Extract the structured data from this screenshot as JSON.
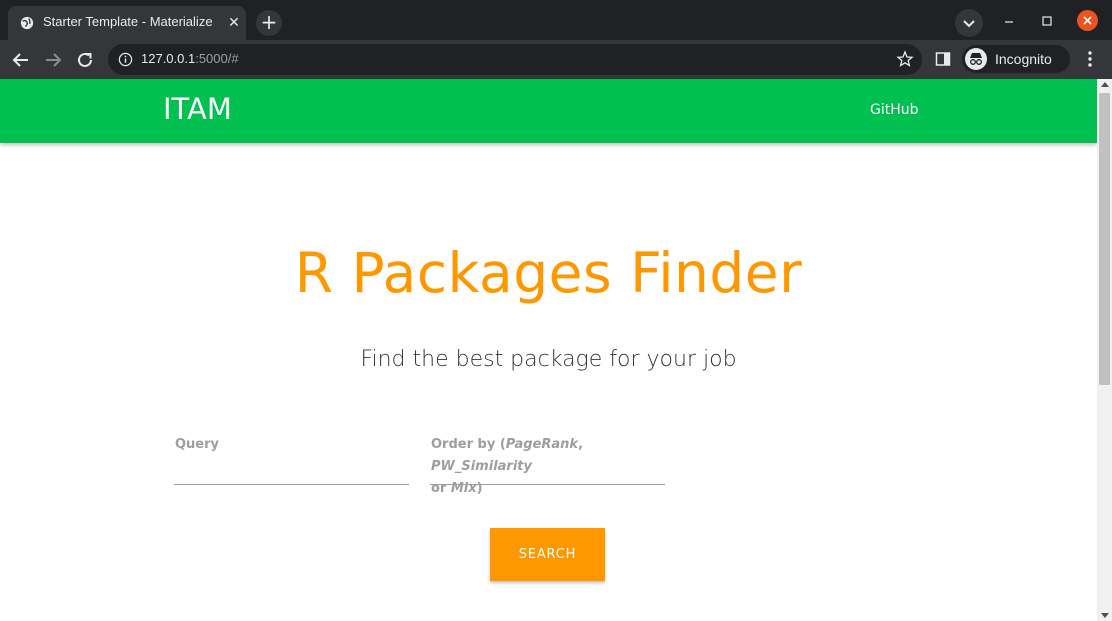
{
  "browser": {
    "tab_title": "Starter Template - Materialize",
    "url_host": "127.0.0.1",
    "url_rest": ":5000/#",
    "profile_label": "Incognito",
    "new_tab_glyph": "+",
    "close_glyph": "✕"
  },
  "navbar": {
    "brand": "ITAM",
    "link_github": "GitHub",
    "color": "#00c050"
  },
  "hero": {
    "title": "R Packages Finder",
    "subtitle": "Find the best package for your job",
    "title_color": "#ff9800"
  },
  "form": {
    "query_label": "Query",
    "order_label_prefix": "Order by (",
    "order_opt1": "PageRank",
    "order_sep1": ", ",
    "order_opt2": "PW_Similarity",
    "order_line2_prefix": "or ",
    "order_opt3": "Mix",
    "order_suffix": ")",
    "query_value": "",
    "order_value": "",
    "search_button": "SEARCH",
    "button_color": "#ff9800"
  },
  "icons": {
    "tab_favicon": "globe-icon",
    "back": "back-arrow-icon",
    "forward": "forward-arrow-icon",
    "reload": "reload-icon",
    "site_info": "info-icon",
    "bookmark": "star-icon",
    "side_panel": "side-panel-icon",
    "incognito": "incognito-icon",
    "menu": "kebab-menu-icon"
  }
}
